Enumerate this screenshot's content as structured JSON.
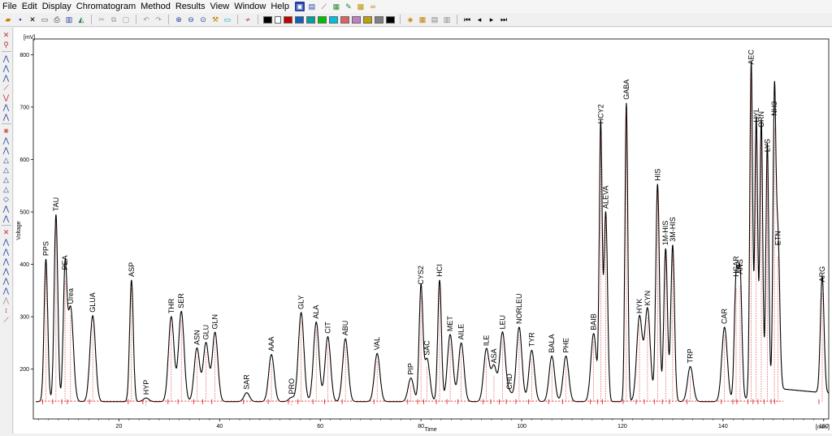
{
  "menu": [
    "File",
    "Edit",
    "Display",
    "Chromatogram",
    "Method",
    "Results",
    "View",
    "Window",
    "Help"
  ],
  "toolbar": {
    "swatch_colors": [
      "#000000",
      "#c00000",
      "#0060c0",
      "#00a0a0",
      "#00c000",
      "#00c0c0",
      "#c060c0",
      "#c09000",
      "#606060",
      "#004080",
      "#000000"
    ]
  },
  "left_tools": [
    "cursor-icon",
    "zoom-icon",
    "peak-start-icon",
    "peak-end-icon",
    "baseline-icon",
    "split-icon",
    "merge-icon",
    "valley-icon",
    "tangent-icon",
    "skim-icon",
    "delete-peak-icon",
    "add-peak-icon",
    "ref-peak-icon",
    "fill-icon",
    "marker-icon"
  ],
  "chart_data": {
    "type": "line",
    "ylabel": "Voltage",
    "yunit": "[mV]",
    "xlabel": "Time",
    "xunit": "[min.]",
    "xlim": [
      3,
      161
    ],
    "ylim": [
      105,
      830
    ],
    "x_ticks": [
      20,
      40,
      60,
      80,
      100,
      120,
      140,
      160
    ],
    "y_ticks": [
      200,
      300,
      400,
      500,
      600,
      700,
      800
    ],
    "baseline": 138,
    "peaks": [
      {
        "name": "PPS",
        "x": 5.5,
        "h": 410
      },
      {
        "name": "TAU",
        "x": 7.5,
        "h": 495
      },
      {
        "name": "PEA",
        "x": 9.3,
        "h": 383
      },
      {
        "name": "Urea",
        "x": 10.4,
        "h": 318
      },
      {
        "name": "GLUA",
        "x": 14.8,
        "h": 302
      },
      {
        "name": "ASP",
        "x": 22.5,
        "h": 370
      },
      {
        "name": "HYP",
        "x": 25.4,
        "h": 145
      },
      {
        "name": "THR",
        "x": 30.4,
        "h": 300
      },
      {
        "name": "SER",
        "x": 32.4,
        "h": 310
      },
      {
        "name": "ASN",
        "x": 35.5,
        "h": 240
      },
      {
        "name": "GLU",
        "x": 37.3,
        "h": 250
      },
      {
        "name": "GLN",
        "x": 39.1,
        "h": 270
      },
      {
        "name": "SAR",
        "x": 45.4,
        "h": 155
      },
      {
        "name": "AAA",
        "x": 50.3,
        "h": 228
      },
      {
        "name": "PRO",
        "x": 54.3,
        "h": 146
      },
      {
        "name": "GLY",
        "x": 56.2,
        "h": 308
      },
      {
        "name": "ALA",
        "x": 59.2,
        "h": 290
      },
      {
        "name": "CIT",
        "x": 61.5,
        "h": 262
      },
      {
        "name": "ABU",
        "x": 65.0,
        "h": 258
      },
      {
        "name": "VAL",
        "x": 71.3,
        "h": 230
      },
      {
        "name": "PIP",
        "x": 78.0,
        "h": 183
      },
      {
        "name": "CYS2",
        "x": 80.0,
        "h": 355
      },
      {
        "name": "SAC",
        "x": 81.2,
        "h": 220
      },
      {
        "name": "HCI",
        "x": 83.7,
        "h": 370
      },
      {
        "name": "MET",
        "x": 85.8,
        "h": 266
      },
      {
        "name": "AILE",
        "x": 88.0,
        "h": 250
      },
      {
        "name": "ILE",
        "x": 93.0,
        "h": 238
      },
      {
        "name": "ASA",
        "x": 94.5,
        "h": 205
      },
      {
        "name": "LEU",
        "x": 96.2,
        "h": 270
      },
      {
        "name": "CHD",
        "x": 97.6,
        "h": 155
      },
      {
        "name": "NORLEU",
        "x": 99.5,
        "h": 280
      },
      {
        "name": "TYR",
        "x": 102.0,
        "h": 236
      },
      {
        "name": "BALA",
        "x": 106.0,
        "h": 225
      },
      {
        "name": "PHE",
        "x": 108.8,
        "h": 225
      },
      {
        "name": "BAIB",
        "x": 114.3,
        "h": 268
      },
      {
        "name": "HCY2",
        "x": 115.7,
        "h": 662
      },
      {
        "name": "ALEVA",
        "x": 116.7,
        "h": 500
      },
      {
        "name": "GABA",
        "x": 120.8,
        "h": 708
      },
      {
        "name": "HYK",
        "x": 123.4,
        "h": 300
      },
      {
        "name": "KYN",
        "x": 125.0,
        "h": 315
      },
      {
        "name": "HIS",
        "x": 127.0,
        "h": 553
      },
      {
        "name": "1M-HIS",
        "x": 128.6,
        "h": 430
      },
      {
        "name": "3M-HIS",
        "x": 130.0,
        "h": 437
      },
      {
        "name": "TRP",
        "x": 133.5,
        "h": 205
      },
      {
        "name": "CAR",
        "x": 140.3,
        "h": 280
      },
      {
        "name": "HCAR",
        "x": 142.6,
        "h": 370
      },
      {
        "name": "ANS",
        "x": 143.4,
        "h": 375
      },
      {
        "name": "AEC",
        "x": 145.6,
        "h": 775
      },
      {
        "name": "HYL",
        "x": 146.6,
        "h": 665
      },
      {
        "name": "ORN",
        "x": 147.6,
        "h": 655
      },
      {
        "name": "LYS",
        "x": 148.8,
        "h": 608
      },
      {
        "name": "NH3",
        "x": 150.2,
        "h": 677
      },
      {
        "name": "ETN",
        "x": 150.9,
        "h": 430
      },
      {
        "name": "ARG",
        "x": 159.7,
        "h": 360
      }
    ]
  }
}
